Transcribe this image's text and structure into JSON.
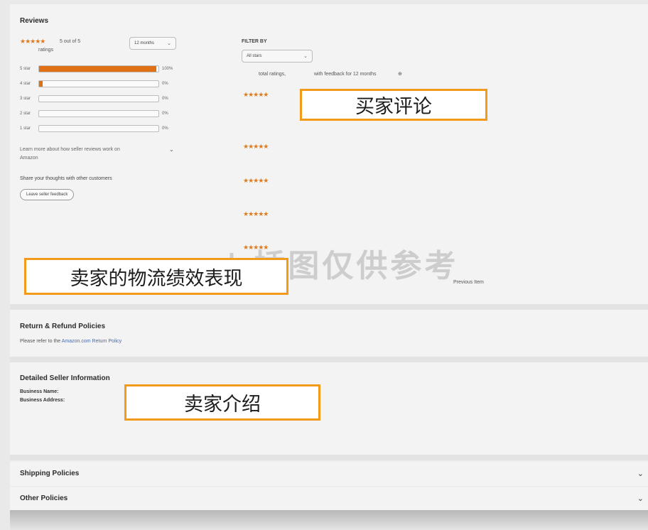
{
  "reviews": {
    "title": "Reviews",
    "rating_stars": "★★★★★",
    "rating_text": "5 out of 5",
    "ratings_label": "ratings",
    "period_select": "12 months",
    "bars": [
      {
        "label": "5 star",
        "pct_text": "100%",
        "fraction": 0.98
      },
      {
        "label": "4 star",
        "pct_text": "0%",
        "fraction": 0.03
      },
      {
        "label": "3 star",
        "pct_text": "0%",
        "fraction": 0
      },
      {
        "label": "2 star",
        "pct_text": "0%",
        "fraction": 0
      },
      {
        "label": "1 star",
        "pct_text": "0%",
        "fraction": 0
      }
    ],
    "learn_more": "Learn more about how seller reviews work on",
    "learn_more_2": "Amazon",
    "share_heading": "Share your thoughts with other customers",
    "leave_feedback": "Leave seller feedback",
    "filter_label": "FILTER BY",
    "filter_select": "All stars",
    "total_ratings": "total ratings,",
    "with_feedback": "with feedback for 12 months",
    "review_stars": [
      "★★★★★",
      "★★★★★",
      "★★★★★",
      "★★★★★",
      "★★★★★"
    ],
    "previous_item": "Previous Item"
  },
  "callouts": {
    "buyer_reviews": "买家评论",
    "seller_performance": "卖家的物流绩效表现",
    "seller_intro": "卖家介绍"
  },
  "watermark": "| 插图仅供参考",
  "return_policies": {
    "title": "Return & Refund Policies",
    "text": "Please refer to the ",
    "link": "Amazon.com Return Policy"
  },
  "detailed_seller": {
    "title": "Detailed Seller Information",
    "business_name": "Business Name:",
    "business_address": "Business Address:"
  },
  "shipping_policies": {
    "title": "Shipping Policies"
  },
  "other_policies": {
    "title": "Other Policies"
  },
  "colors": {
    "accent": "#e07014",
    "callout_border": "#f39a1a"
  }
}
